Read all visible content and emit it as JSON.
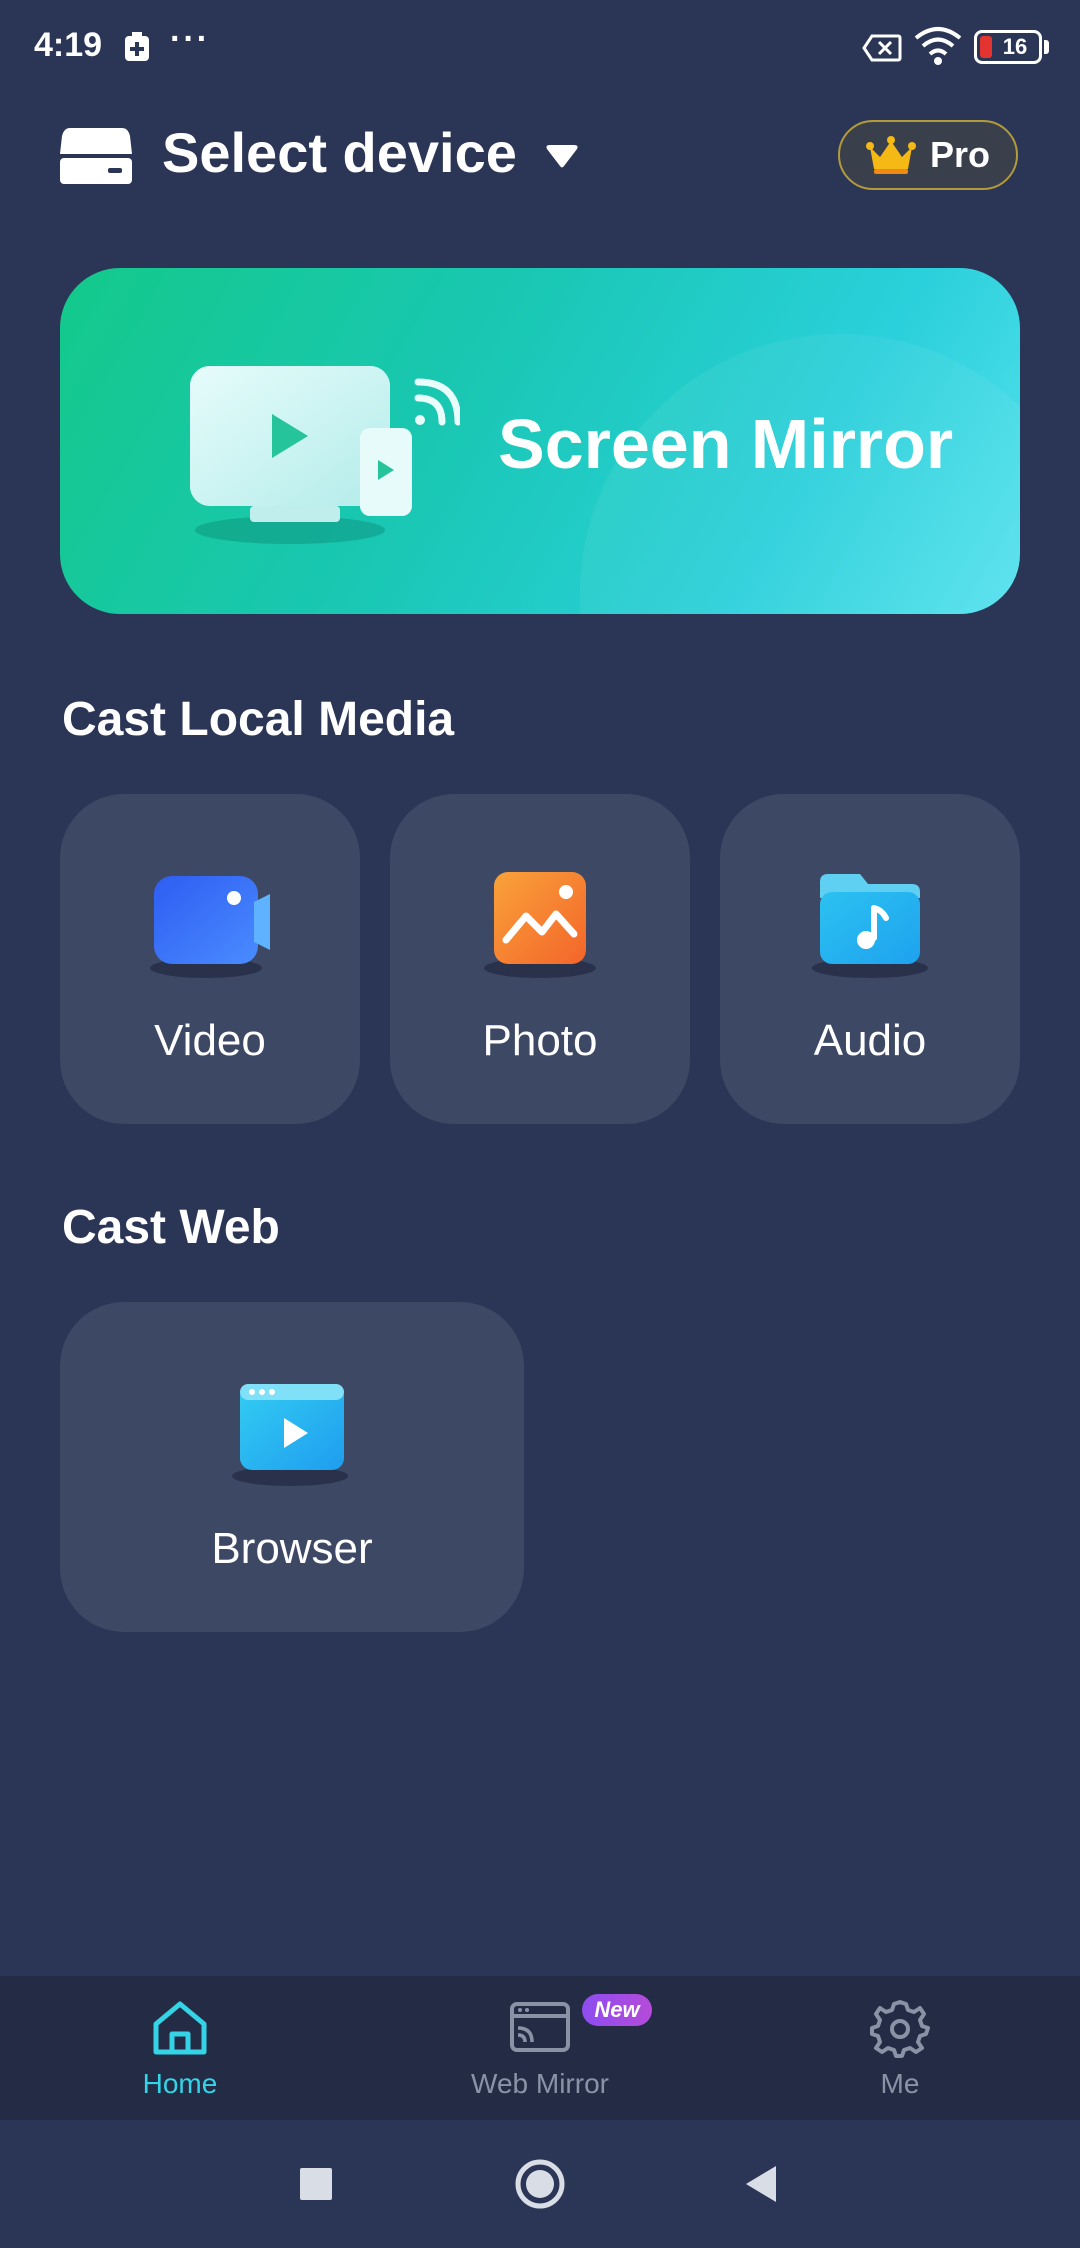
{
  "status_bar": {
    "time": "4:19",
    "dots": "···",
    "battery_level": "16",
    "battery_color": "#e3342f"
  },
  "header": {
    "select_device_label": "Select device",
    "pro_label": "Pro",
    "pro_icon": "crown-icon",
    "device_icon": "display-device-icon"
  },
  "mirror_card": {
    "label": "Screen Mirror",
    "icon": "tv-phone-cast-icon"
  },
  "cast_local_media": {
    "title": "Cast Local Media",
    "items": [
      {
        "label": "Video",
        "icon": "video-camera-icon"
      },
      {
        "label": "Photo",
        "icon": "photo-icon"
      },
      {
        "label": "Audio",
        "icon": "music-folder-icon"
      }
    ]
  },
  "cast_web": {
    "title": "Cast Web",
    "items": [
      {
        "label": "Browser",
        "icon": "browser-play-icon"
      }
    ]
  },
  "bottom_nav": {
    "items": [
      {
        "label": "Home",
        "icon": "home-icon",
        "active": true
      },
      {
        "label": "Web Mirror",
        "icon": "web-mirror-icon",
        "badge": "New"
      },
      {
        "label": "Me",
        "icon": "gear-icon"
      }
    ]
  },
  "colors": {
    "background": "#2b3656",
    "accent": "#35d3e6",
    "tile": "#3d4865",
    "nav": "#242c45"
  }
}
